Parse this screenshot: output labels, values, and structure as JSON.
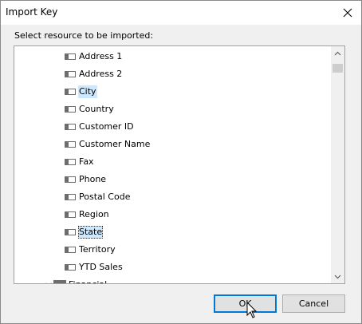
{
  "window": {
    "title": "Import Key"
  },
  "prompt": "Select resource to be imported:",
  "tree": {
    "items": [
      {
        "label": "Address 1",
        "state": "normal"
      },
      {
        "label": "Address 2",
        "state": "normal"
      },
      {
        "label": "City",
        "state": "selected"
      },
      {
        "label": "Country",
        "state": "normal"
      },
      {
        "label": "Customer ID",
        "state": "normal"
      },
      {
        "label": "Customer Name",
        "state": "normal"
      },
      {
        "label": "Fax",
        "state": "normal"
      },
      {
        "label": "Phone",
        "state": "normal"
      },
      {
        "label": "Postal Code",
        "state": "normal"
      },
      {
        "label": "Region",
        "state": "normal"
      },
      {
        "label": "State",
        "state": "focused"
      },
      {
        "label": "Territory",
        "state": "normal"
      },
      {
        "label": "YTD Sales",
        "state": "normal"
      }
    ],
    "group": {
      "label": "Financial",
      "expanded": true
    }
  },
  "buttons": {
    "ok": "OK",
    "cancel": "Cancel"
  },
  "icons": {
    "close": "close-icon",
    "field": "field-icon",
    "folder": "folder-icon",
    "chevron": "chevron-down-icon"
  },
  "colors": {
    "selection": "#cce8ff",
    "default_button_border": "#0078d7"
  }
}
